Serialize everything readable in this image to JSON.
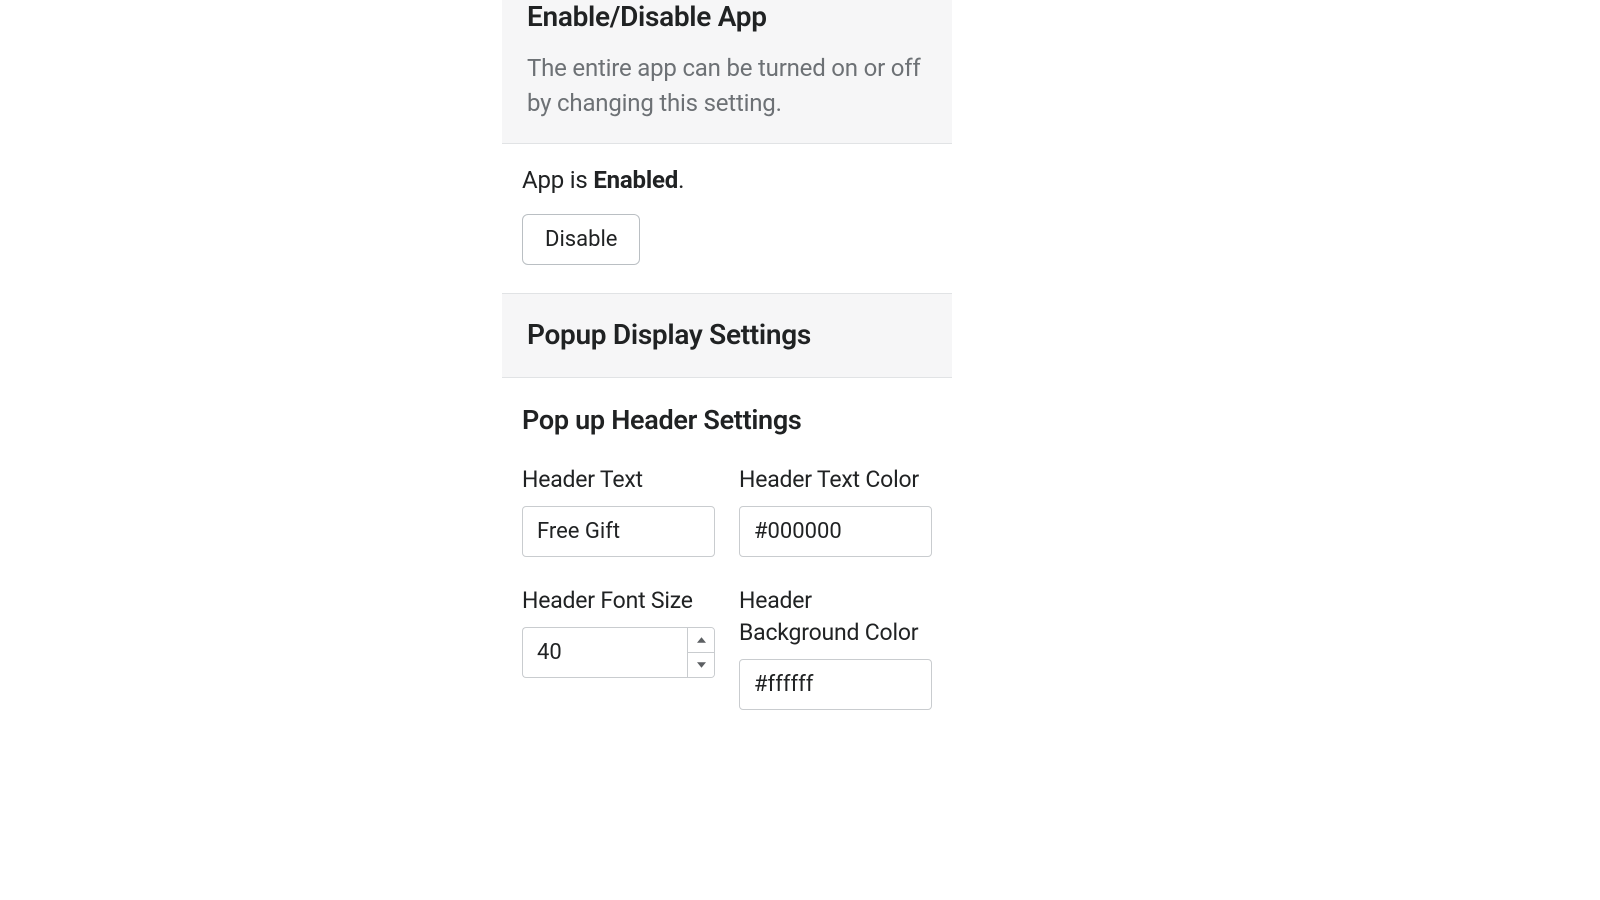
{
  "sections": {
    "enableDisable": {
      "title": "Enable/Disable App",
      "description": "The entire app can be turned on or off by changing this setting.",
      "status_prefix": "App is ",
      "status_value": "Enabled",
      "status_suffix": ".",
      "button_label": "Disable"
    },
    "popupDisplay": {
      "title": "Popup Display Settings"
    },
    "popupHeader": {
      "title": "Pop up Header Settings",
      "fields": {
        "headerText": {
          "label": "Header Text",
          "value": "Free Gift"
        },
        "headerTextColor": {
          "label": "Header Text Color",
          "value": "#000000"
        },
        "headerFontSize": {
          "label": "Header Font Size",
          "value": "40"
        },
        "headerBackgroundColor": {
          "label": "Header Background Color",
          "value": "#ffffff"
        }
      }
    }
  }
}
